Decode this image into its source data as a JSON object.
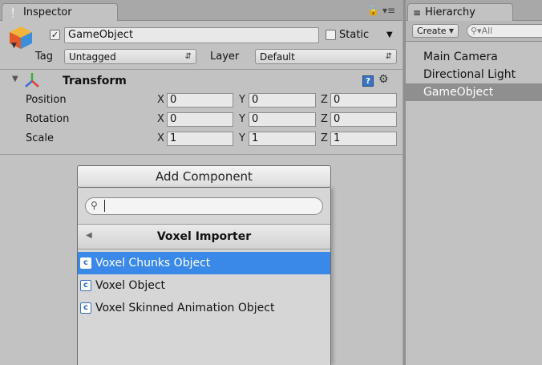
{
  "inspector": {
    "tab_title": "Inspector",
    "gameobject": {
      "name": "GameObject",
      "active_checked": true,
      "static_label": "Static",
      "tag_label": "Tag",
      "tag_value": "Untagged",
      "layer_label": "Layer",
      "layer_value": "Default"
    },
    "transform": {
      "title": "Transform",
      "rows": [
        {
          "label": "Position",
          "x": "0",
          "y": "0",
          "z": "0"
        },
        {
          "label": "Rotation",
          "x": "0",
          "y": "0",
          "z": "0"
        },
        {
          "label": "Scale",
          "x": "1",
          "y": "1",
          "z": "1"
        }
      ],
      "axis_labels": {
        "x": "X",
        "y": "Y",
        "z": "Z"
      }
    },
    "add_component_label": "Add Component",
    "popup": {
      "search_value": "",
      "header": "Voxel Importer",
      "items": [
        {
          "label": "Voxel Chunks Object",
          "selected": true
        },
        {
          "label": "Voxel Object",
          "selected": false
        },
        {
          "label": "Voxel Skinned Animation Object",
          "selected": false
        }
      ]
    }
  },
  "hierarchy": {
    "tab_title": "Hierarchy",
    "create_label": "Create",
    "search_placeholder": "All",
    "items": [
      {
        "label": "Main Camera",
        "selected": false
      },
      {
        "label": "Directional Light",
        "selected": false
      },
      {
        "label": "GameObject",
        "selected": true
      }
    ]
  },
  "colors": {
    "selection": "#3a88e8",
    "panel_bg": "#c2c2c2",
    "hierarchy_selection": "#8f8f8f"
  }
}
